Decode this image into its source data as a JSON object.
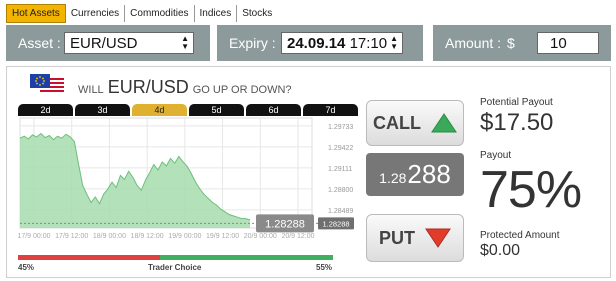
{
  "tabs": [
    {
      "label": "Hot Assets",
      "active": true
    },
    {
      "label": "Currencies",
      "active": false
    },
    {
      "label": "Commodities",
      "active": false
    },
    {
      "label": "Indices",
      "active": false
    },
    {
      "label": "Stocks",
      "active": false
    }
  ],
  "asset": {
    "label": "Asset :",
    "value": "EUR/USD"
  },
  "expiry": {
    "label": "Expiry :",
    "date": "24.09.14",
    "time": "17:10"
  },
  "amount": {
    "label": "Amount :",
    "currency": "$",
    "value": "10"
  },
  "question": {
    "prefix": "WILL",
    "pair": "EUR/USD",
    "suffix": "GO UP OR DOWN?"
  },
  "periods": [
    {
      "label": "2d",
      "active": false
    },
    {
      "label": "3d",
      "active": false
    },
    {
      "label": "4d",
      "active": true
    },
    {
      "label": "5d",
      "active": false
    },
    {
      "label": "6d",
      "active": false
    },
    {
      "label": "7d",
      "active": false
    }
  ],
  "chart_data": {
    "type": "area",
    "yticks": [
      "1.29733",
      "1.29422",
      "1.29111",
      "1.28800",
      "1.28489"
    ],
    "xticks": [
      "17/9 00:00",
      "17/9 12:00",
      "18/9 00:00",
      "18/9 12:00",
      "19/9 00:00",
      "19/9 12:00",
      "20/9 00:00",
      "20/9 12:00"
    ],
    "ylim": [
      1.2822,
      1.2985
    ],
    "values": [
      1.2955,
      1.2958,
      1.2954,
      1.296,
      1.2957,
      1.2962,
      1.2956,
      1.2959,
      1.2953,
      1.2958,
      1.2955,
      1.2961,
      1.2957,
      1.295,
      1.2917,
      1.2885,
      1.2872,
      1.286,
      1.2868,
      1.2858,
      1.2872,
      1.288,
      1.289,
      1.2882,
      1.29,
      1.2894,
      1.2906,
      1.2897,
      1.2885,
      1.2878,
      1.2893,
      1.2904,
      1.2916,
      1.2908,
      1.292,
      1.2914,
      1.2925,
      1.2918,
      1.2928,
      1.292,
      1.2913,
      1.2902,
      1.289,
      1.288,
      1.2872,
      1.2866,
      1.286,
      1.2856,
      1.285,
      1.2846,
      1.2842,
      1.284,
      1.2838,
      1.2836,
      1.2836,
      1.2834
    ],
    "current": "1.28288",
    "axis_current": "1.28288"
  },
  "price": {
    "small": "1.28",
    "big": "288"
  },
  "call_label": "CALL",
  "put_label": "PUT",
  "payout": {
    "label": "Potential Payout",
    "value": "$17.50"
  },
  "percent": {
    "label": "Payout",
    "value": "75%"
  },
  "protected": {
    "label": "Protected Amount",
    "value": "$0.00"
  },
  "trader_choice": {
    "label": "Trader Choice",
    "put_pct": "45%",
    "call_pct": "55%",
    "put_share": 0.45,
    "put_color": "#e04040",
    "call_color": "#40b060"
  },
  "colors": {
    "accent": "#f2b400",
    "call_arrow": "#3aaa5a",
    "put_arrow": "#e03c2c",
    "area": "#a6dcae"
  }
}
